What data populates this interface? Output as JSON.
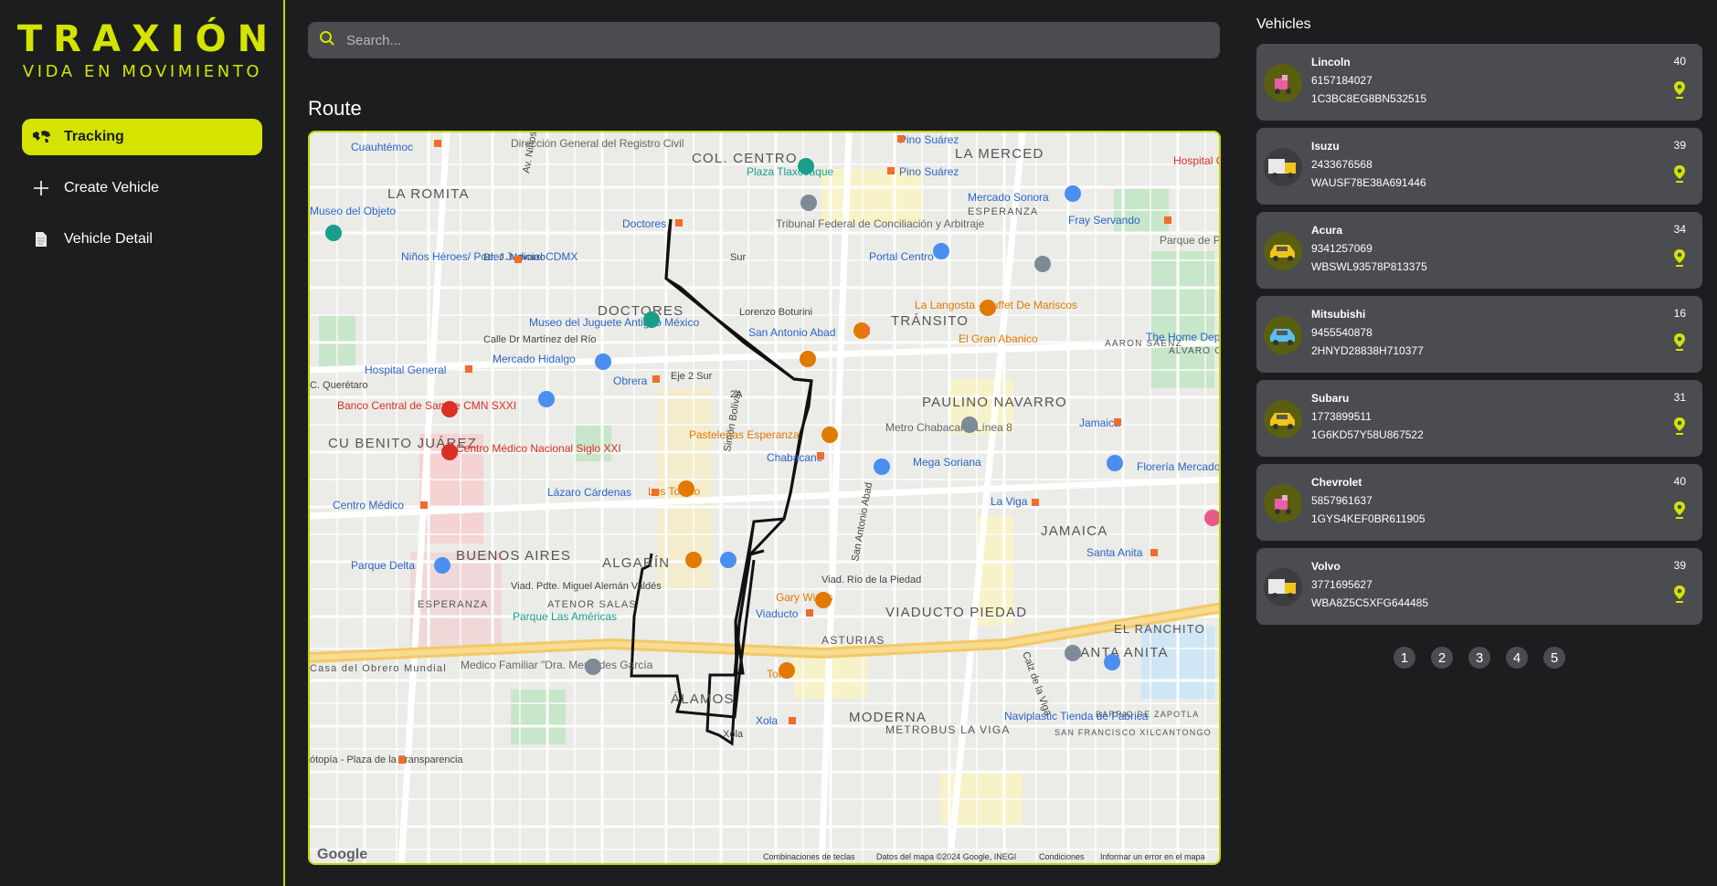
{
  "brand": {
    "title": "TRAXIÓN",
    "subtitle": "VIDA EN MOVIMIENTO"
  },
  "nav": [
    {
      "label": "Tracking",
      "icon": "world-map-icon",
      "active": true
    },
    {
      "label": "Create Vehicle",
      "icon": "plus-icon",
      "active": false
    },
    {
      "label": "Vehicle Detail",
      "icon": "document-icon",
      "active": false
    }
  ],
  "search": {
    "placeholder": "Search..."
  },
  "route": {
    "title": "Route"
  },
  "map": {
    "labels": {
      "col_centro": "COL. CENTRO",
      "la_romita": "LA ROMITA",
      "doctores": "DOCTORES",
      "transito": "TRÁNSITO",
      "paulino_navarro": "PAULINO NAVARRO",
      "cu_benito_juarez": "CU BENITO JUÁREZ",
      "buenos_aires": "BUENOS AIRES",
      "algarin": "ALGARÍN",
      "la_merced": "LA MERCED",
      "jamaica": "JAMAICA",
      "el_ranchito": "EL RANCHITO",
      "santa_anita": "SANTA ANITA",
      "viaducto_piedad": "VIADUCTO PIEDAD",
      "alamos": "ÁLAMOS",
      "moderna": "MODERNA",
      "asturias": "ASTURIAS",
      "esperanza": "ESPERANZA",
      "atenor_salas": "ATENOR SALAS",
      "metrobus_la_viga": "METROBUS LA VIGA",
      "esperanza2": "ESPERANZA",
      "pino_suarez_1": "Pino Suárez",
      "pino_suarez_2": "Pino Suárez",
      "plaza_tlaxcoaque": "Plaza Tlaxcoaque",
      "mercado_sonora": "Mercado Sonora",
      "fray_servando": "Fray Servando",
      "doctores_metro": "Doctores",
      "tribunal": "Tribunal Federal de Conciliación y Arbitraje",
      "ninos_heroes": "Niños Héroes/ Poder Judicial CDMX",
      "portal_centro": "Portal Centro",
      "la_langosta": "La Langosta - Buffet De Mariscos",
      "el_gran_abanico": "El Gran Abanico",
      "museo_juguete": "Museo del Juguete Antiguo México",
      "san_antonio_abad": "San Antonio Abad",
      "mercado_hidalgo": "Mercado Hidalgo",
      "hospital_general": "Hospital General",
      "obrera": "Obrera",
      "banco_central": "Banco Central de Sangre CMN SXXI",
      "metro_chabacano": "Metro Chabacano Línea 8",
      "pastelerias": "Pastelerías Esperanza",
      "chabacano": "Chabacano",
      "mega_soriana": "Mega Soriana",
      "centro_medico_nacional": "Centro Médico Nacional Siglo XXI",
      "lazaro_cardenas": "Lázaro Cárdenas",
      "los_toluco": "Los Toluco",
      "la_viga": "La Viga",
      "centro_medico": "Centro Médico",
      "viad_aleman": "Viad. Pdte. Miguel Alemán Valdés",
      "viad_piedad": "Viad. Río de la Piedad",
      "parque_delta": "Parque Delta",
      "santa_anita_metro": "Santa Anita",
      "gary_wings": "Gary Wings",
      "viaducto": "Viaducto",
      "parque_americas": "Parque Las Américas",
      "medico_familiar": "Medico Familiar \"Dra. Mercedes García",
      "toks": "Toks",
      "xola": "Xola",
      "xola2": "Xola",
      "naviplastic": "Naviplastic Tienda de Fabrica",
      "san_francisco": "SAN FRANCISCO XILCANTONGO",
      "barrio_zapotla": "BARRIO DE ZAPOTLA",
      "the_home_depot": "The Home Depot",
      "jamaica_metro": "Jamaica",
      "floreria": "Florería Mercado J",
      "alvaro_obregon": "ALVARO OBREGON",
      "aaron_saenz": "AARON SÁENZ",
      "direccion_general": "Dirección General del Registro Civil",
      "cuauhtemoc": "Cuauhtémoc",
      "museo_objeto": "Museo del Objeto",
      "parque_periodista": "Parque de Periodista Ilustres",
      "hospital_right": "Hospital G",
      "esperanza_top": "ESPERANZA",
      "casa_obrero": "Casa del Obrero Mundial",
      "eje2_sur": "Eje 2 Sur",
      "lorenzo_boturini": "Lorenzo Boturini",
      "calle_dr_martinez": "Calle Dr Martínez del Río",
      "dr_j_navarro": "Dr. J. Navarro",
      "c_queretaro": "C. Querétaro",
      "mia_transparencia": "ótopía - Plaza de la Transparencia",
      "sur_label": "Sur",
      "av_ninos_heroes": "Av. Niños Héroes",
      "simon_bolivar": "Simón Bolívar",
      "san_antonio_abad_av": "San Antonio Abad",
      "calz_de_la_viga": "Calz de la Viga",
      "eje_2a": "2A",
      "google": "Google",
      "footer_keys": "Combinaciones de teclas",
      "footer_data": "Datos del mapa ©2024 Google, INEGI",
      "footer_terms": "Condiciones",
      "footer_report": "Informar un error en el mapa"
    }
  },
  "vehicles": {
    "title": "Vehicles",
    "items": [
      {
        "name": "Lincoln",
        "phone": "6157184027",
        "vin": "1C3BC8EG8BN532515",
        "count": "40",
        "avatar": "pink-scooter-icon"
      },
      {
        "name": "Isuzu",
        "phone": "2433676568",
        "vin": "WAUSF78E38A691446",
        "count": "39",
        "avatar": "yellow-truck-icon"
      },
      {
        "name": "Acura",
        "phone": "9341257069",
        "vin": "WBSWL93578P813375",
        "count": "34",
        "avatar": "yellow-car-icon"
      },
      {
        "name": "Mitsubishi",
        "phone": "9455540878",
        "vin": "2HNYD28838H710377",
        "count": "16",
        "avatar": "blue-car-icon"
      },
      {
        "name": "Subaru",
        "phone": "1773899511",
        "vin": "1G6KD57Y58U867522",
        "count": "31",
        "avatar": "yellow-car-icon"
      },
      {
        "name": "Chevrolet",
        "phone": "5857961637",
        "vin": "1GYS4KEF0BR611905",
        "count": "40",
        "avatar": "pink-scooter-icon"
      },
      {
        "name": "Volvo",
        "phone": "3771695627",
        "vin": "WBA8Z5C5XFG644485",
        "count": "39",
        "avatar": "yellow-truck-icon"
      }
    ]
  },
  "pagination": [
    "1",
    "2",
    "3",
    "4",
    "5"
  ],
  "colors": {
    "accent": "#d4e300",
    "background": "#1b1d1f",
    "card": "#4a4c4f",
    "route": "#111111"
  }
}
